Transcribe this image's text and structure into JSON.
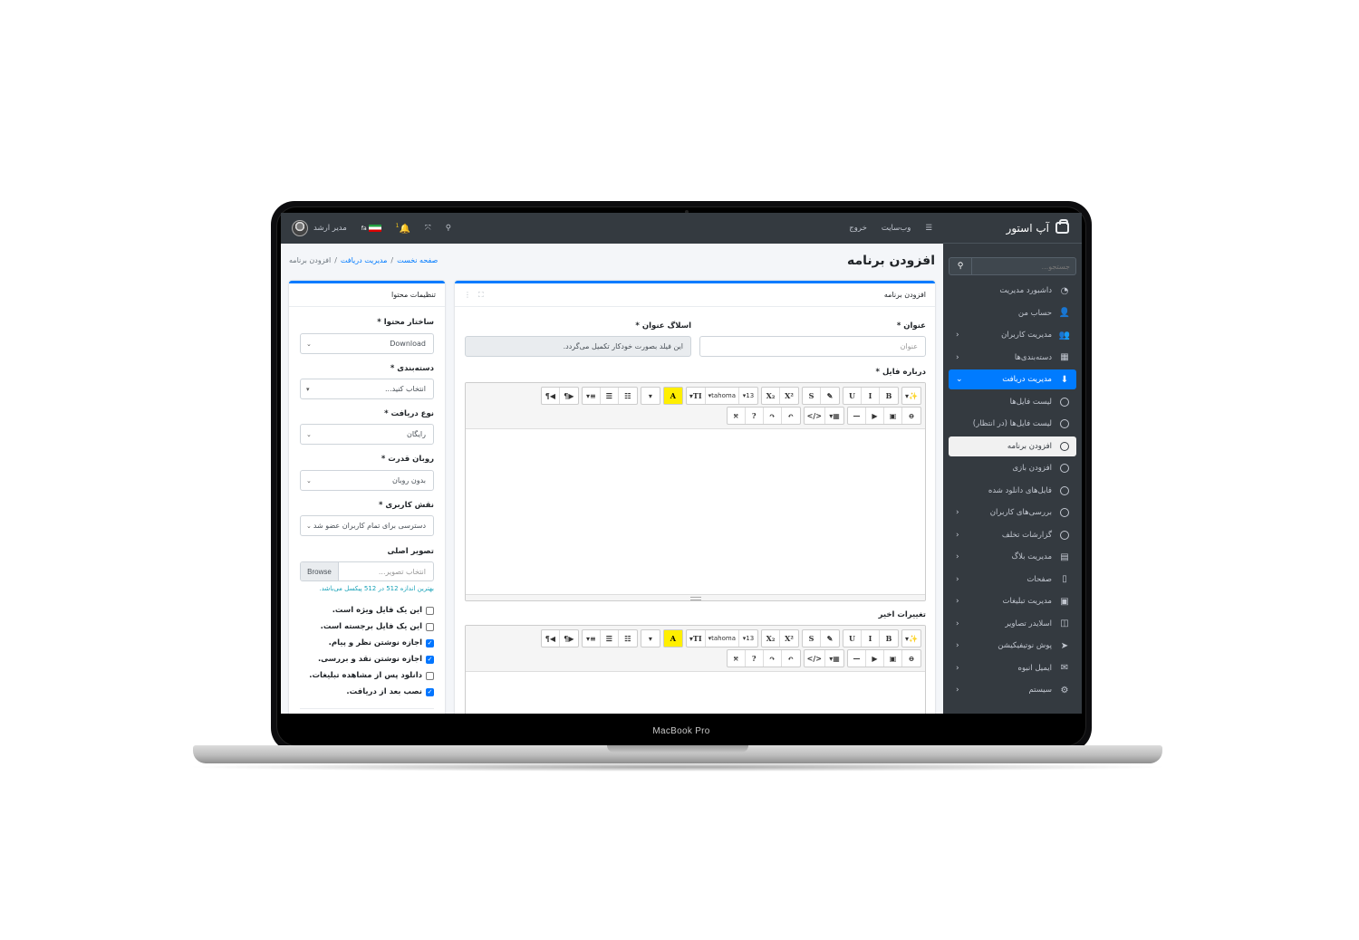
{
  "device": {
    "label": "MacBook Pro"
  },
  "sidebar": {
    "brand": "آپ استور",
    "search_placeholder": "جستجو...",
    "items": [
      {
        "label": "داشبورد مدیریت",
        "icon": "dashboard-icon",
        "glyph": "◔",
        "type": "icon",
        "chevron": false,
        "state": ""
      },
      {
        "label": "حساب من",
        "icon": "user-icon",
        "glyph": "👤",
        "type": "icon",
        "chevron": false,
        "state": ""
      },
      {
        "label": "مدیریت کاربران",
        "icon": "users-icon",
        "glyph": "👥",
        "type": "icon",
        "chevron": true,
        "state": ""
      },
      {
        "label": "دسته‌بندی‌ها",
        "icon": "th-list-icon",
        "glyph": "▦",
        "type": "icon",
        "chevron": true,
        "state": ""
      },
      {
        "label": "مدیریت دریافت",
        "icon": "download-icon",
        "glyph": "⬇",
        "type": "icon",
        "chevron": true,
        "state": "active"
      },
      {
        "label": "لیست فایل‌ها",
        "icon": "circle-icon",
        "type": "circle",
        "chevron": false,
        "state": ""
      },
      {
        "label": "لیست فایل‌ها (در انتظار)",
        "icon": "circle-icon",
        "type": "circle",
        "chevron": false,
        "state": ""
      },
      {
        "label": "افزودن برنامه",
        "icon": "circle-icon",
        "type": "circle",
        "chevron": false,
        "state": "selected"
      },
      {
        "label": "افزودن بازی",
        "icon": "circle-icon",
        "type": "circle",
        "chevron": false,
        "state": ""
      },
      {
        "label": "فایل‌های دانلود شده",
        "icon": "circle-icon",
        "type": "circle",
        "chevron": false,
        "state": ""
      },
      {
        "label": "بررسی‌های کاربران",
        "icon": "circle-icon",
        "type": "circle",
        "chevron": true,
        "state": ""
      },
      {
        "label": "گزارشات تخلف",
        "icon": "circle-icon",
        "type": "circle",
        "chevron": true,
        "state": ""
      },
      {
        "label": "مدیریت بلاگ",
        "icon": "blog-icon",
        "glyph": "▤",
        "type": "icon",
        "chevron": true,
        "state": ""
      },
      {
        "label": "صفحات",
        "icon": "file-icon",
        "glyph": "▯",
        "type": "icon",
        "chevron": true,
        "state": ""
      },
      {
        "label": "مدیریت تبلیغات",
        "icon": "ad-icon",
        "glyph": "▣",
        "type": "icon",
        "chevron": true,
        "state": ""
      },
      {
        "label": "اسلایدر تصاویر",
        "icon": "images-icon",
        "glyph": "◫",
        "type": "icon",
        "chevron": true,
        "state": ""
      },
      {
        "label": "پوش نوتیفیکیشن",
        "icon": "paper-plane-icon",
        "glyph": "➤",
        "type": "icon",
        "chevron": true,
        "state": ""
      },
      {
        "label": "ایمیل انبوه",
        "icon": "envelope-icon",
        "glyph": "✉",
        "type": "icon",
        "chevron": true,
        "state": ""
      },
      {
        "label": "سیستم",
        "icon": "cog-icon",
        "glyph": "⚙",
        "type": "icon",
        "chevron": true,
        "state": ""
      }
    ]
  },
  "topbar": {
    "menu_icon": "☰",
    "website": "وب‌سایت",
    "logout": "خروج",
    "user_name": "مدیر ارشد",
    "lang_badge": "fa",
    "notification_count": "1"
  },
  "page": {
    "title": "افزودن برنامه",
    "breadcrumb": [
      "صفحه نخست",
      "مدیریت دریافت",
      "افزودن برنامه"
    ]
  },
  "main_card": {
    "header": "افزودن برنامه",
    "title_label": "عنوان *",
    "title_placeholder": "عنوان",
    "slug_label": "اسلاگ عنوان *",
    "slug_value": "این فیلد بصورت خودکار تکمیل می‌گردد.",
    "about_label": "درباره فایل *",
    "changes_label": "تغییرات اخیر",
    "toolbar_row1": [
      "¶◀",
      "¶▶",
      "▾≡",
      "☰",
      "☷",
      "▾",
      "A",
      "▾TI",
      "▾tahoma",
      "▾13",
      "X₂",
      "X²",
      "S",
      "✎",
      "U",
      "I",
      "B",
      "▾✨"
    ],
    "toolbar_row2": [
      "⤧",
      "?",
      "↷",
      "↶",
      "</>",
      "▾▦",
      "—",
      "▶",
      "▣",
      "⊖"
    ]
  },
  "side_card": {
    "header": "تنظیمات محتوا",
    "structure_label": "ساختار محتوا *",
    "structure_value": "Download",
    "category_label": "دسته‌بندی *",
    "category_value": "انتخاب کنید...",
    "dltype_label": "نوع دریافت *",
    "dltype_value": "رایگان",
    "powered_label": "روبان قدرت *",
    "powered_value": "بدون روبان",
    "role_label": "نقش کاربری *",
    "role_value": "دسترسی برای تمام کاربران عضو شد",
    "image_label": "تصویر اصلی",
    "image_placeholder": "انتخاب تصویر...",
    "browse": "Browse",
    "image_hint": "بهترین اندازه 512 در 512 پیکسل می‌باشد.",
    "checkboxes": [
      {
        "label": "این یک فایل ویژه است.",
        "checked": false
      },
      {
        "label": "این یک فایل برجسته است.",
        "checked": false
      },
      {
        "label": "اجازه نوشتن نظر و پیام.",
        "checked": true
      },
      {
        "label": "اجازه نوشتن نقد و بررسی.",
        "checked": true
      },
      {
        "label": "دانلود پس از مشاهده تبلیغات.",
        "checked": false
      },
      {
        "label": "نصب بعد از دریافت.",
        "checked": true
      }
    ]
  }
}
